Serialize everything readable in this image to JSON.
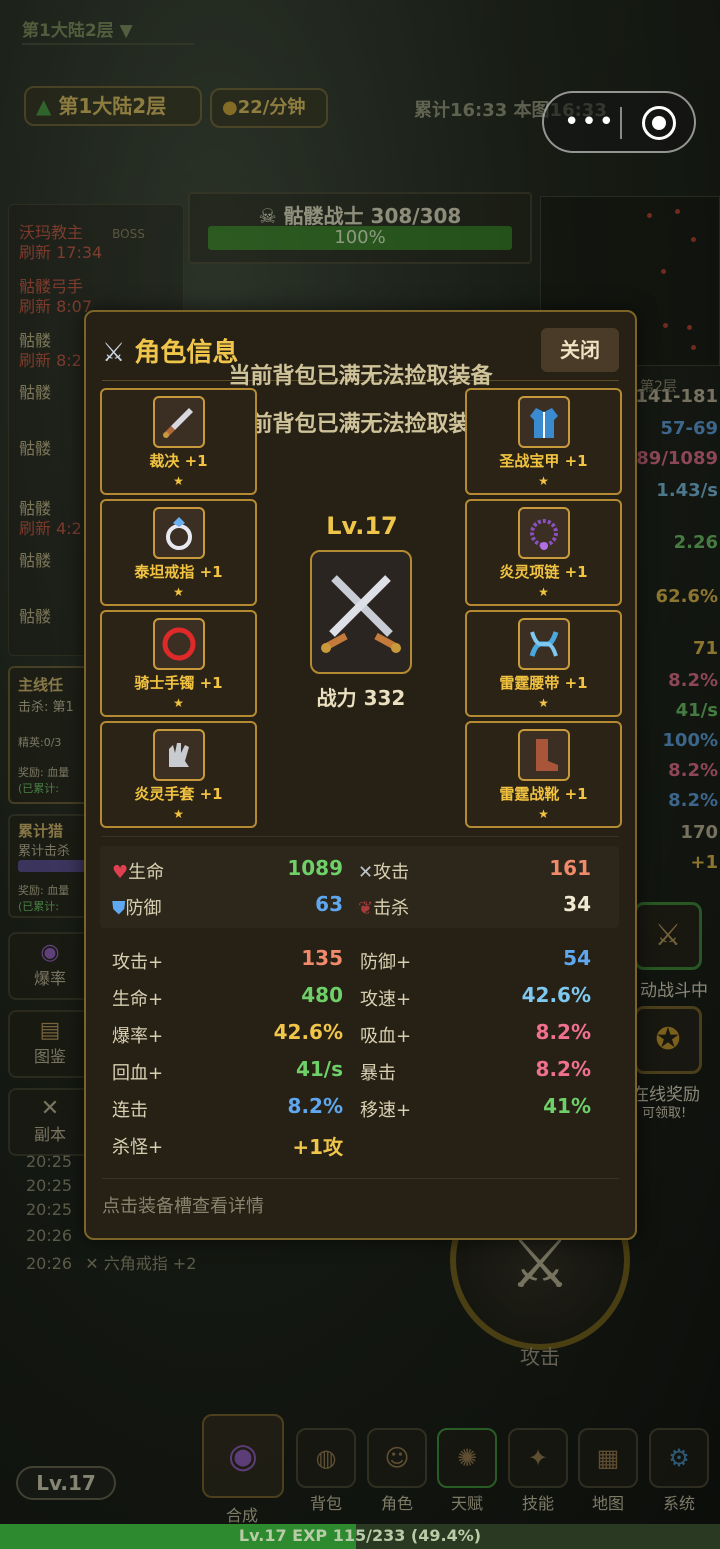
{
  "topbar": {
    "area": "第1大陆2层 ▼"
  },
  "hud": {
    "area": "第1大陆2层",
    "rate": "22/分钟",
    "timer": "累计16:33 本图16:33"
  },
  "capsule": {
    "more": "•••"
  },
  "enemy": {
    "name": "骷髅战士 308/308",
    "hp": "100%",
    "hp_fraction": 1.0
  },
  "left_list": [
    {
      "text": "沃玛教主",
      "tag": "BOSS"
    },
    {
      "text": "刷新 17:34"
    },
    {
      "text": "骷髅弓手"
    },
    {
      "text": "刷新 8:07"
    },
    {
      "text": "骷髅"
    },
    {
      "text": "刷新 8:2"
    },
    {
      "text": "骷髅"
    },
    {
      "text": "骷髅"
    },
    {
      "text": "骷髅"
    },
    {
      "text": "刷新 4:2"
    },
    {
      "text": "骷髅"
    },
    {
      "text": "骷髅"
    }
  ],
  "quest": {
    "title": "主线任",
    "kill": "击杀: 第1",
    "elite": "精英:0/3",
    "reward": "奖励: 血量",
    "acc": "(已累计: ",
    "title2": "累计猎",
    "kill2": "累计击杀",
    "reward2": "奖励: 血量",
    "acc2": "(已累计: "
  },
  "left_buttons": [
    {
      "label": "爆率"
    },
    {
      "label": "图鉴"
    },
    {
      "label": "副本"
    }
  ],
  "right_stats": [
    "141-181",
    "57-69",
    "89/1089",
    "1.43/s",
    "2.26",
    "62.6%",
    "71",
    "8.2%",
    "41/s",
    "100%",
    "8.2%",
    "8.2%",
    "170",
    "+1"
  ],
  "map_label": "第2层",
  "log": [
    {
      "time": "20:25"
    },
    {
      "time": "20:25"
    },
    {
      "time": "20:25"
    },
    {
      "time": "20:26"
    },
    {
      "time": "20:26",
      "text": "六角戒指 +2"
    }
  ],
  "side_buttons": {
    "auto": "动战斗中",
    "online": "在线奖励",
    "online_sub": "可领取!"
  },
  "attack_button": {
    "label": "攻击"
  },
  "nav": [
    {
      "label": "合成"
    },
    {
      "label": "背包"
    },
    {
      "label": "角色"
    },
    {
      "label": "天赋"
    },
    {
      "label": "技能"
    },
    {
      "label": "地图"
    },
    {
      "label": "系统"
    }
  ],
  "level_pill": "Lv.17",
  "exp": {
    "text": "Lv.17  EXP 115/233 (49.4%)",
    "fraction": 0.494
  },
  "modal": {
    "title": "角色信息",
    "close": "关闭",
    "toasts": [
      "当前背包已满无法捡取装备",
      "当前背包已满无法捡取装备"
    ],
    "level": "Lv.17",
    "power": "战力 332",
    "slots_left": [
      {
        "name": "裁决 +1",
        "icon": "dagger-icon",
        "star": "★"
      },
      {
        "name": "泰坦戒指 +1",
        "icon": "ring-icon",
        "star": "★"
      },
      {
        "name": "骑士手镯 +1",
        "icon": "bracelet-icon",
        "star": "★"
      },
      {
        "name": "炎灵手套 +1",
        "icon": "glove-icon",
        "star": "★"
      }
    ],
    "slots_right": [
      {
        "name": "圣战宝甲 +1",
        "icon": "robe-icon",
        "star": "★"
      },
      {
        "name": "炎灵项链 +1",
        "icon": "necklace-icon",
        "star": "★"
      },
      {
        "name": "雷霆腰带 +1",
        "icon": "belt-icon",
        "star": "★"
      },
      {
        "name": "雷霆战靴 +1",
        "icon": "boot-icon",
        "star": "★"
      }
    ],
    "core": [
      {
        "label": "生命",
        "value": "1089",
        "color": "#6fd06a"
      },
      {
        "label": "攻击",
        "value": "161",
        "color": "#f08a6a"
      },
      {
        "label": "防御",
        "value": "63",
        "color": "#5fa8f0"
      },
      {
        "label": "击杀",
        "value": "34",
        "color": "#f0e8d0"
      }
    ],
    "bonus": [
      {
        "l1": "攻击+",
        "v1": "135",
        "c1": "#f08a6a",
        "l2": "防御+",
        "v2": "54",
        "c2": "#5fa8f0"
      },
      {
        "l1": "生命+",
        "v1": "480",
        "c1": "#6fd06a",
        "l2": "攻速+",
        "v2": "42.6%",
        "c2": "#7fc8f0"
      },
      {
        "l1": "爆率+",
        "v1": "42.6%",
        "c1": "#f0c64a",
        "l2": "吸血+",
        "v2": "8.2%",
        "c2": "#f07090"
      },
      {
        "l1": "回血+",
        "v1": "41/s",
        "c1": "#6fd06a",
        "l2": "暴击",
        "v2": "8.2%",
        "c2": "#f07090"
      },
      {
        "l1": "连击",
        "v1": "8.2%",
        "c1": "#5fa8f0",
        "l2": "移速+",
        "v2": "41%",
        "c2": "#6fd06a"
      },
      {
        "l1": "杀怪+",
        "v1": "+1攻",
        "c1": "#f0c64a",
        "l2": "",
        "v2": "",
        "c2": "#fff"
      }
    ],
    "hint": "点击装备槽查看详情"
  }
}
